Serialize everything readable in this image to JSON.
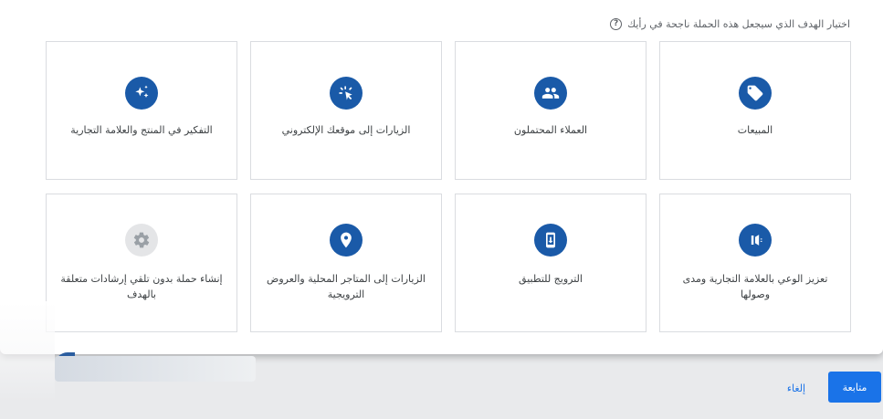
{
  "header": {
    "question": "اختيار الهدف الذي سيجعل هذه الحملة ناجحة في رأيك",
    "help_glyph": "?"
  },
  "cards": [
    {
      "label": "المبيعات",
      "icon": "sales-tag-icon"
    },
    {
      "label": "العملاء المحتملون",
      "icon": "leads-people-icon"
    },
    {
      "label": "الزيارات إلى موقعك الإلكتروني",
      "icon": "website-traffic-icon"
    },
    {
      "label": "التفكير في المنتج والعلامة التجارية",
      "icon": "sparkle-consideration-icon"
    },
    {
      "label": "تعزيز الوعي بالعلامة التجارية ومدى وصولها",
      "icon": "awareness-megaphone-icon"
    },
    {
      "label": "الترويج للتطبيق",
      "icon": "app-promotion-phone-icon"
    },
    {
      "label": "الزيارات إلى المتاجر المحلية والعروض الترويجية",
      "icon": "location-pin-icon"
    },
    {
      "label": "إنشاء حملة بدون تلقي إرشادات متعلقة بالهدف",
      "icon": "gear-icon"
    }
  ],
  "footer": {
    "continue_label": "متابعة",
    "cancel_label": "إلغاء"
  },
  "colors": {
    "icon_bg": "#1a5aa8",
    "icon_bg_disabled": "#e4e5e7",
    "primary_button": "#1a73e8"
  }
}
